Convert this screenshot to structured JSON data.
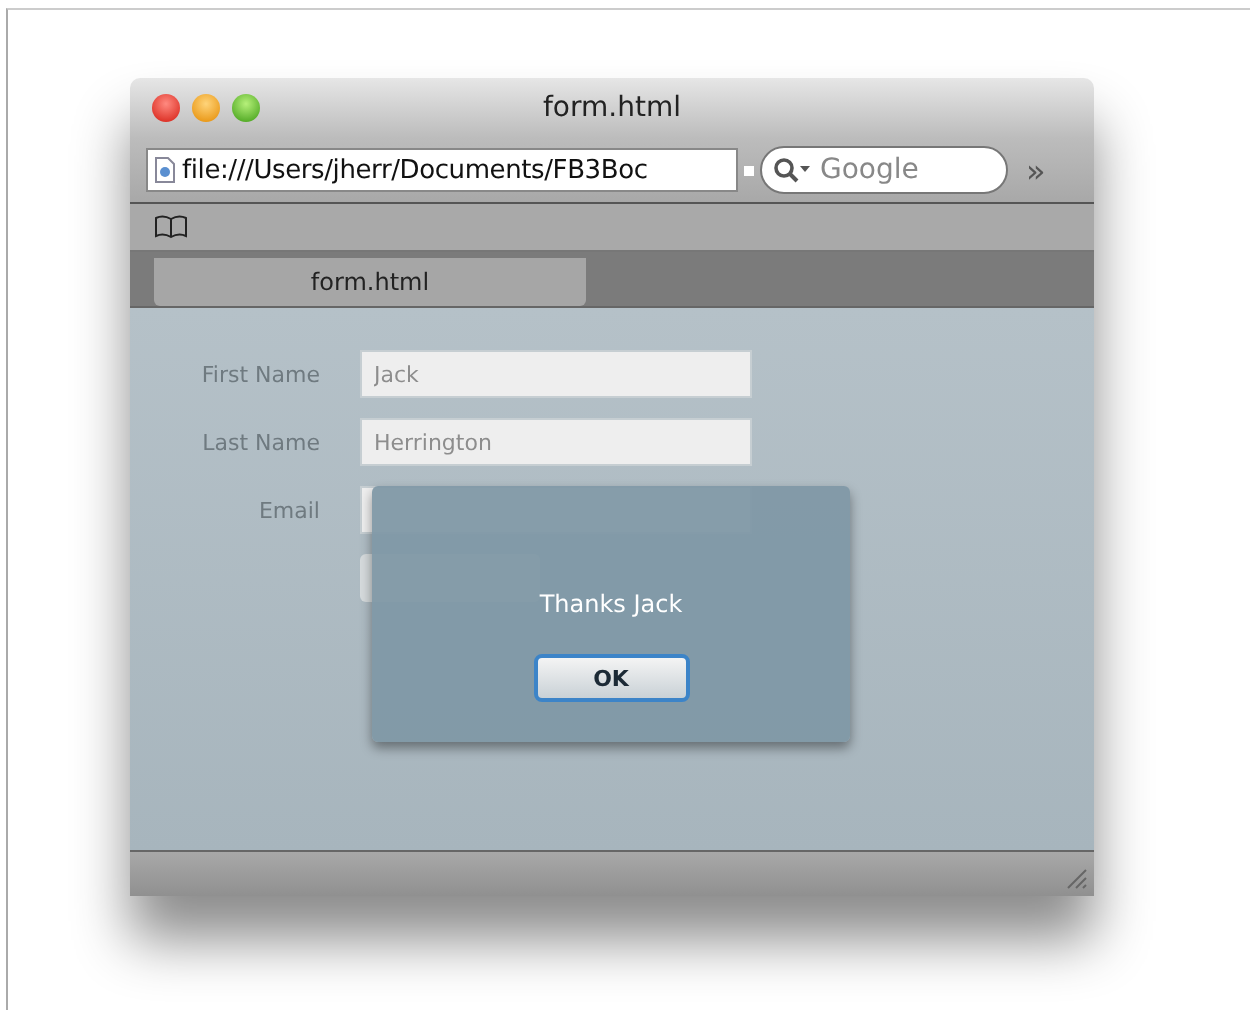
{
  "window": {
    "title": "form.html"
  },
  "toolbar": {
    "address": "file:///Users/jherr/Documents/FB3Boc",
    "search": {
      "placeholder": "Google"
    },
    "overflow": "»"
  },
  "tabs": [
    {
      "label": "form.html",
      "selected": true
    }
  ],
  "form": {
    "fields": [
      {
        "label": "First Name",
        "value": "Jack"
      },
      {
        "label": "Last Name",
        "value": "Herrington"
      },
      {
        "label": "Email"
      }
    ]
  },
  "dialog": {
    "message": "Thanks Jack",
    "buttons": [
      "OK"
    ]
  }
}
